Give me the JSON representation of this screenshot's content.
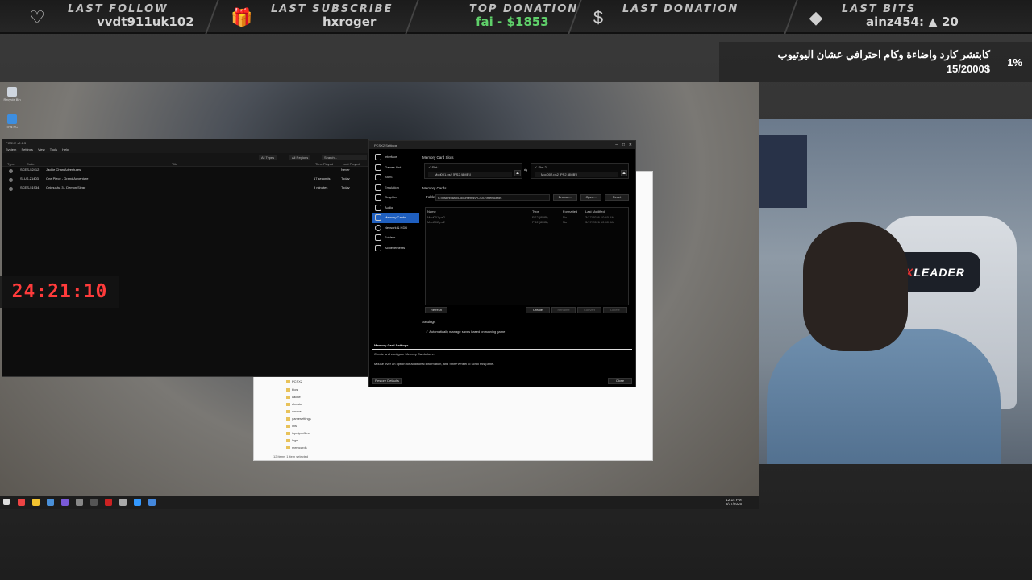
{
  "overlay": {
    "last_follow_label": "LAST FOLLOW",
    "last_follow_value": "vvdt911uk102",
    "last_subscribe_label": "LAST SUBSCRIBE",
    "last_subscribe_value": "hxroger",
    "top_donation_label": "TOP DONATION",
    "top_donation_value": "fai - $1853",
    "last_donation_label": "LAST DONATION",
    "last_donation_value": "",
    "last_bits_label": "LAST BITS",
    "last_bits_value": "ainz454: ▲ 20",
    "goal_text": "كابتشر كارد واضاءة وكام احترافي عشان اليوتيوب",
    "goal_amount": "15/2000$",
    "goal_percent": "1%",
    "timer": "24:21:10"
  },
  "desktop_icons": [
    {
      "label": "Recycle Bin"
    },
    {
      "label": "This PC"
    }
  ],
  "pcsx_main": {
    "title": "PCSX2 v2.6.3",
    "menu": [
      "System",
      "Settings",
      "View",
      "Tools",
      "Help"
    ],
    "filters": [
      "All Types",
      "All Regions",
      "Search..."
    ],
    "columns": [
      "Type",
      "Code",
      "Title",
      "Time Played",
      "Last Played"
    ],
    "games": [
      {
        "code": "SCES-52412",
        "title": "Jackie Chan Adventures",
        "time": "",
        "last": "Never"
      },
      {
        "code": "SLUS-21403",
        "title": "One Piece - Grand Adventure",
        "time": "17 seconds",
        "last": "Today"
      },
      {
        "code": "SCES-51934",
        "title": "Onimusha 3 - Demon Siege",
        "time": "9 minutes",
        "last": "Today"
      }
    ]
  },
  "settings": {
    "title": "PCSX2 Settings",
    "sidebar": [
      {
        "label": "Interface",
        "active": false
      },
      {
        "label": "Games List",
        "active": false
      },
      {
        "label": "BIOS",
        "active": false
      },
      {
        "label": "Emulation",
        "active": false
      },
      {
        "label": "Graphics",
        "active": false
      },
      {
        "label": "Audio",
        "active": false
      },
      {
        "label": "Memory Cards",
        "active": true
      },
      {
        "label": "Network & HDD",
        "active": false
      },
      {
        "label": "Folders",
        "active": false
      },
      {
        "label": "Achievements",
        "active": false
      }
    ],
    "slots_heading": "Memory Card Slots",
    "slot1_label": "Slot 1",
    "slot1_file": "Mcd001.ps2 [PS2 (8MB)]",
    "slot2_label": "Slot 2",
    "slot2_file": "Mcd002.ps2 [PS2 (8MB)]",
    "cards_heading": "Memory Cards",
    "folder_label": "Folder:",
    "folder_path": "C:\\Users\\Ilian\\Documents\\PCSX2\\memcards",
    "browse": "Browse...",
    "open": "Open...",
    "reset": "Reset",
    "table_cols": [
      "Name",
      "Type",
      "Formatted",
      "Last Modified"
    ],
    "cards": [
      {
        "name": "Mcd001.ps2",
        "type": "PS2 (8MB)",
        "formatted": "No",
        "modified": "3/17/2026 10:40 AM"
      },
      {
        "name": "Mcd002.ps2",
        "type": "PS2 (8MB)",
        "formatted": "No",
        "modified": "3/17/2026 10:40 AM"
      }
    ],
    "refresh": "Refresh",
    "create": "Create",
    "rename": "Rename",
    "convert": "Convert",
    "delete": "Delete",
    "settings_heading": "Settings",
    "auto_manage": "Automatically manage saves based on running game",
    "help_title": "Memory Card Settings",
    "help_line1": "Create and configure Memory Cards here.",
    "help_line2": "Mouse over an option for additional information, and Shift+Wheel to scroll this panel.",
    "restore": "Restore Defaults",
    "close": "Close"
  },
  "explorer": {
    "items": [
      "PCSX2",
      "bios",
      "cache",
      "cheats",
      "covers",
      "gamesettings",
      "inis",
      "inputprofiles",
      "logs",
      "memcards"
    ],
    "status": "12 items   1 item selected"
  },
  "taskbar": {
    "time": "12:14 PM",
    "date": "3/17/2026"
  },
  "webcam": {
    "chair_brand_x": "X",
    "chair_brand": "LEADER"
  }
}
